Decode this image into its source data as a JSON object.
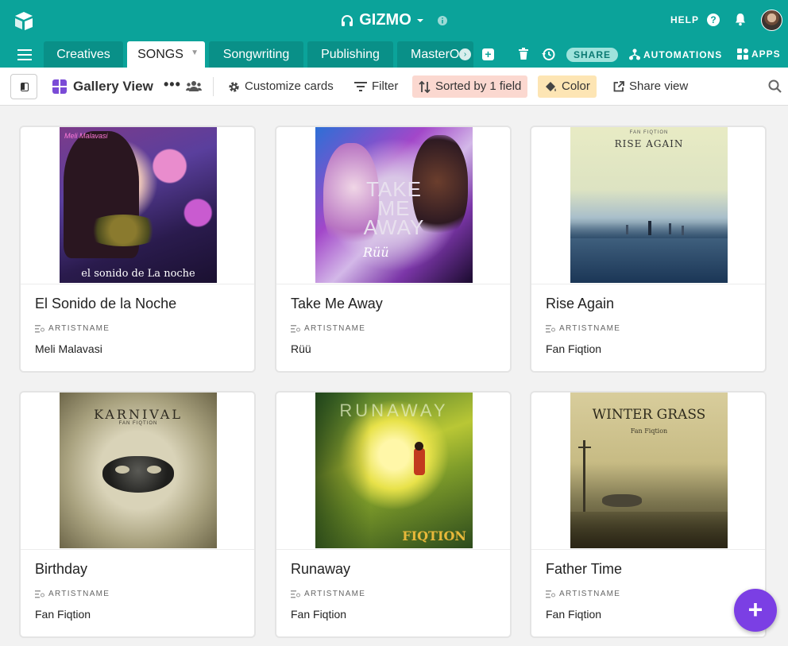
{
  "header": {
    "base_name": "GIZMO",
    "help_label": "HELP",
    "help_icon_glyph": "?"
  },
  "tabs": [
    {
      "label": "Creatives"
    },
    {
      "label": "SONGS"
    },
    {
      "label": "Songwriting"
    },
    {
      "label": "Publishing"
    },
    {
      "label": "MasterO"
    }
  ],
  "toolbar": {
    "share_label": "SHARE",
    "automations_label": "AUTOMATIONS",
    "apps_label": "APPS"
  },
  "view": {
    "name": "Gallery View",
    "more_glyph": "•••",
    "customize_label": "Customize cards",
    "filter_label": "Filter",
    "sort_label": "Sorted by 1 field",
    "color_label": "Color",
    "share_view_label": "Share view"
  },
  "cards": [
    {
      "title": "El Sonido de la Noche",
      "field_label": "ARTISTNAME",
      "artist": "Meli Malavasi",
      "art_text": "el sonido de La noche",
      "art_top": "Meli Malavasi"
    },
    {
      "title": "Take Me Away",
      "field_label": "ARTISTNAME",
      "artist": "Rüü",
      "art_text": "TAKE ME AWAY",
      "art_sig": "Rüü"
    },
    {
      "title": "Rise Again",
      "field_label": "ARTISTNAME",
      "artist": "Fan Fiqtion",
      "art_text": "RISE AGAIN",
      "art_small": "FAN FIQTION"
    },
    {
      "title": "Birthday",
      "field_label": "ARTISTNAME",
      "artist": "Fan Fiqtion",
      "art_text": "KARNIVAL",
      "art_small": "FAN FIQTION"
    },
    {
      "title": "Runaway",
      "field_label": "ARTISTNAME",
      "artist": "Fan Fiqtion",
      "art_text": "RUNAWAY",
      "art_small": "FIQTION"
    },
    {
      "title": "Father Time",
      "field_label": "ARTISTNAME",
      "artist": "Fan Fiqtion",
      "art_text": "WINTER GRASS",
      "art_small": "Fan Fiqtion"
    }
  ],
  "fab_label": "+",
  "colors": {
    "brand": "#0ba39a",
    "view_icon": "#7a4bd6",
    "sort_bg": "#fbd8d0",
    "color_bg": "#fde5b4",
    "fab": "#7b3fe4"
  }
}
